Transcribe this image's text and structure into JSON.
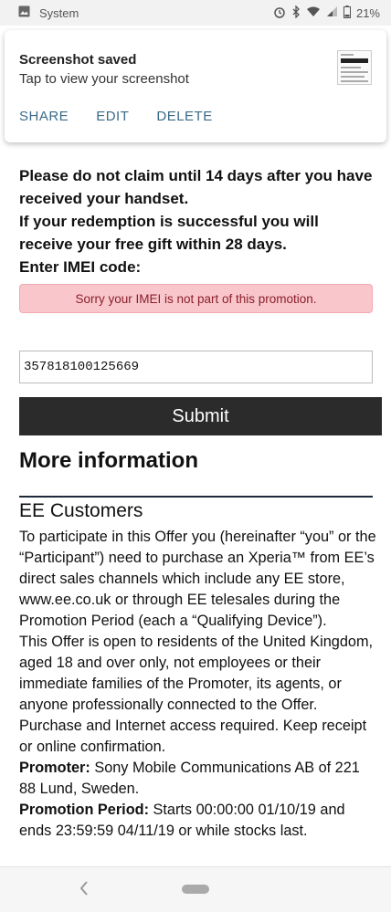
{
  "status_bar": {
    "app_label": "System",
    "battery": "21%",
    "icons": [
      "image-icon",
      "alarm-icon",
      "bluetooth-icon",
      "wifi-icon",
      "signal-icon",
      "battery-icon"
    ]
  },
  "notification": {
    "title": "Screenshot saved",
    "subtitle": "Tap to view your screenshot",
    "actions": [
      "SHARE",
      "EDIT",
      "DELETE"
    ]
  },
  "form": {
    "para1": "Please do not claim until 14 days after you have received your handset.",
    "para2": "If your redemption is successful you will receive your free gift within 28 days.",
    "imei_label": "Enter IMEI code:",
    "error": "Sorry your IMEI is not part of this promotion.",
    "imei_value": "357818100125669",
    "submit_label": "Submit"
  },
  "more_info": {
    "heading": "More information",
    "section_title": "EE Customers",
    "p1": "To participate in this Offer you (hereinafter “you” or the “Participant”) need to purchase an Xperia™ from EE’s direct sales channels which include any EE store, www.ee.co.uk or through EE telesales during the Promotion Period (each a “Qualifying Device”).",
    "p2": "This Offer is open to residents of the United Kingdom, aged 18 and over only, not employees or their immediate families of the Promoter, its agents, or anyone professionally connected to the Offer. Purchase and Internet access required. Keep receipt or online confirmation.",
    "promoter_label": "Promoter:",
    "promoter_value": " Sony Mobile Communications AB of 221 88 Lund, Sweden.",
    "period_label": "Promotion Period:",
    "period_value": " Starts 00:00:00 01/10/19 and ends 23:59:59 04/11/19 or while stocks last."
  },
  "colors": {
    "accent": "#3a6b88",
    "error_bg": "#f9c6cb",
    "error_text": "#8a1f2b",
    "button_bg": "#2b2b2b"
  }
}
